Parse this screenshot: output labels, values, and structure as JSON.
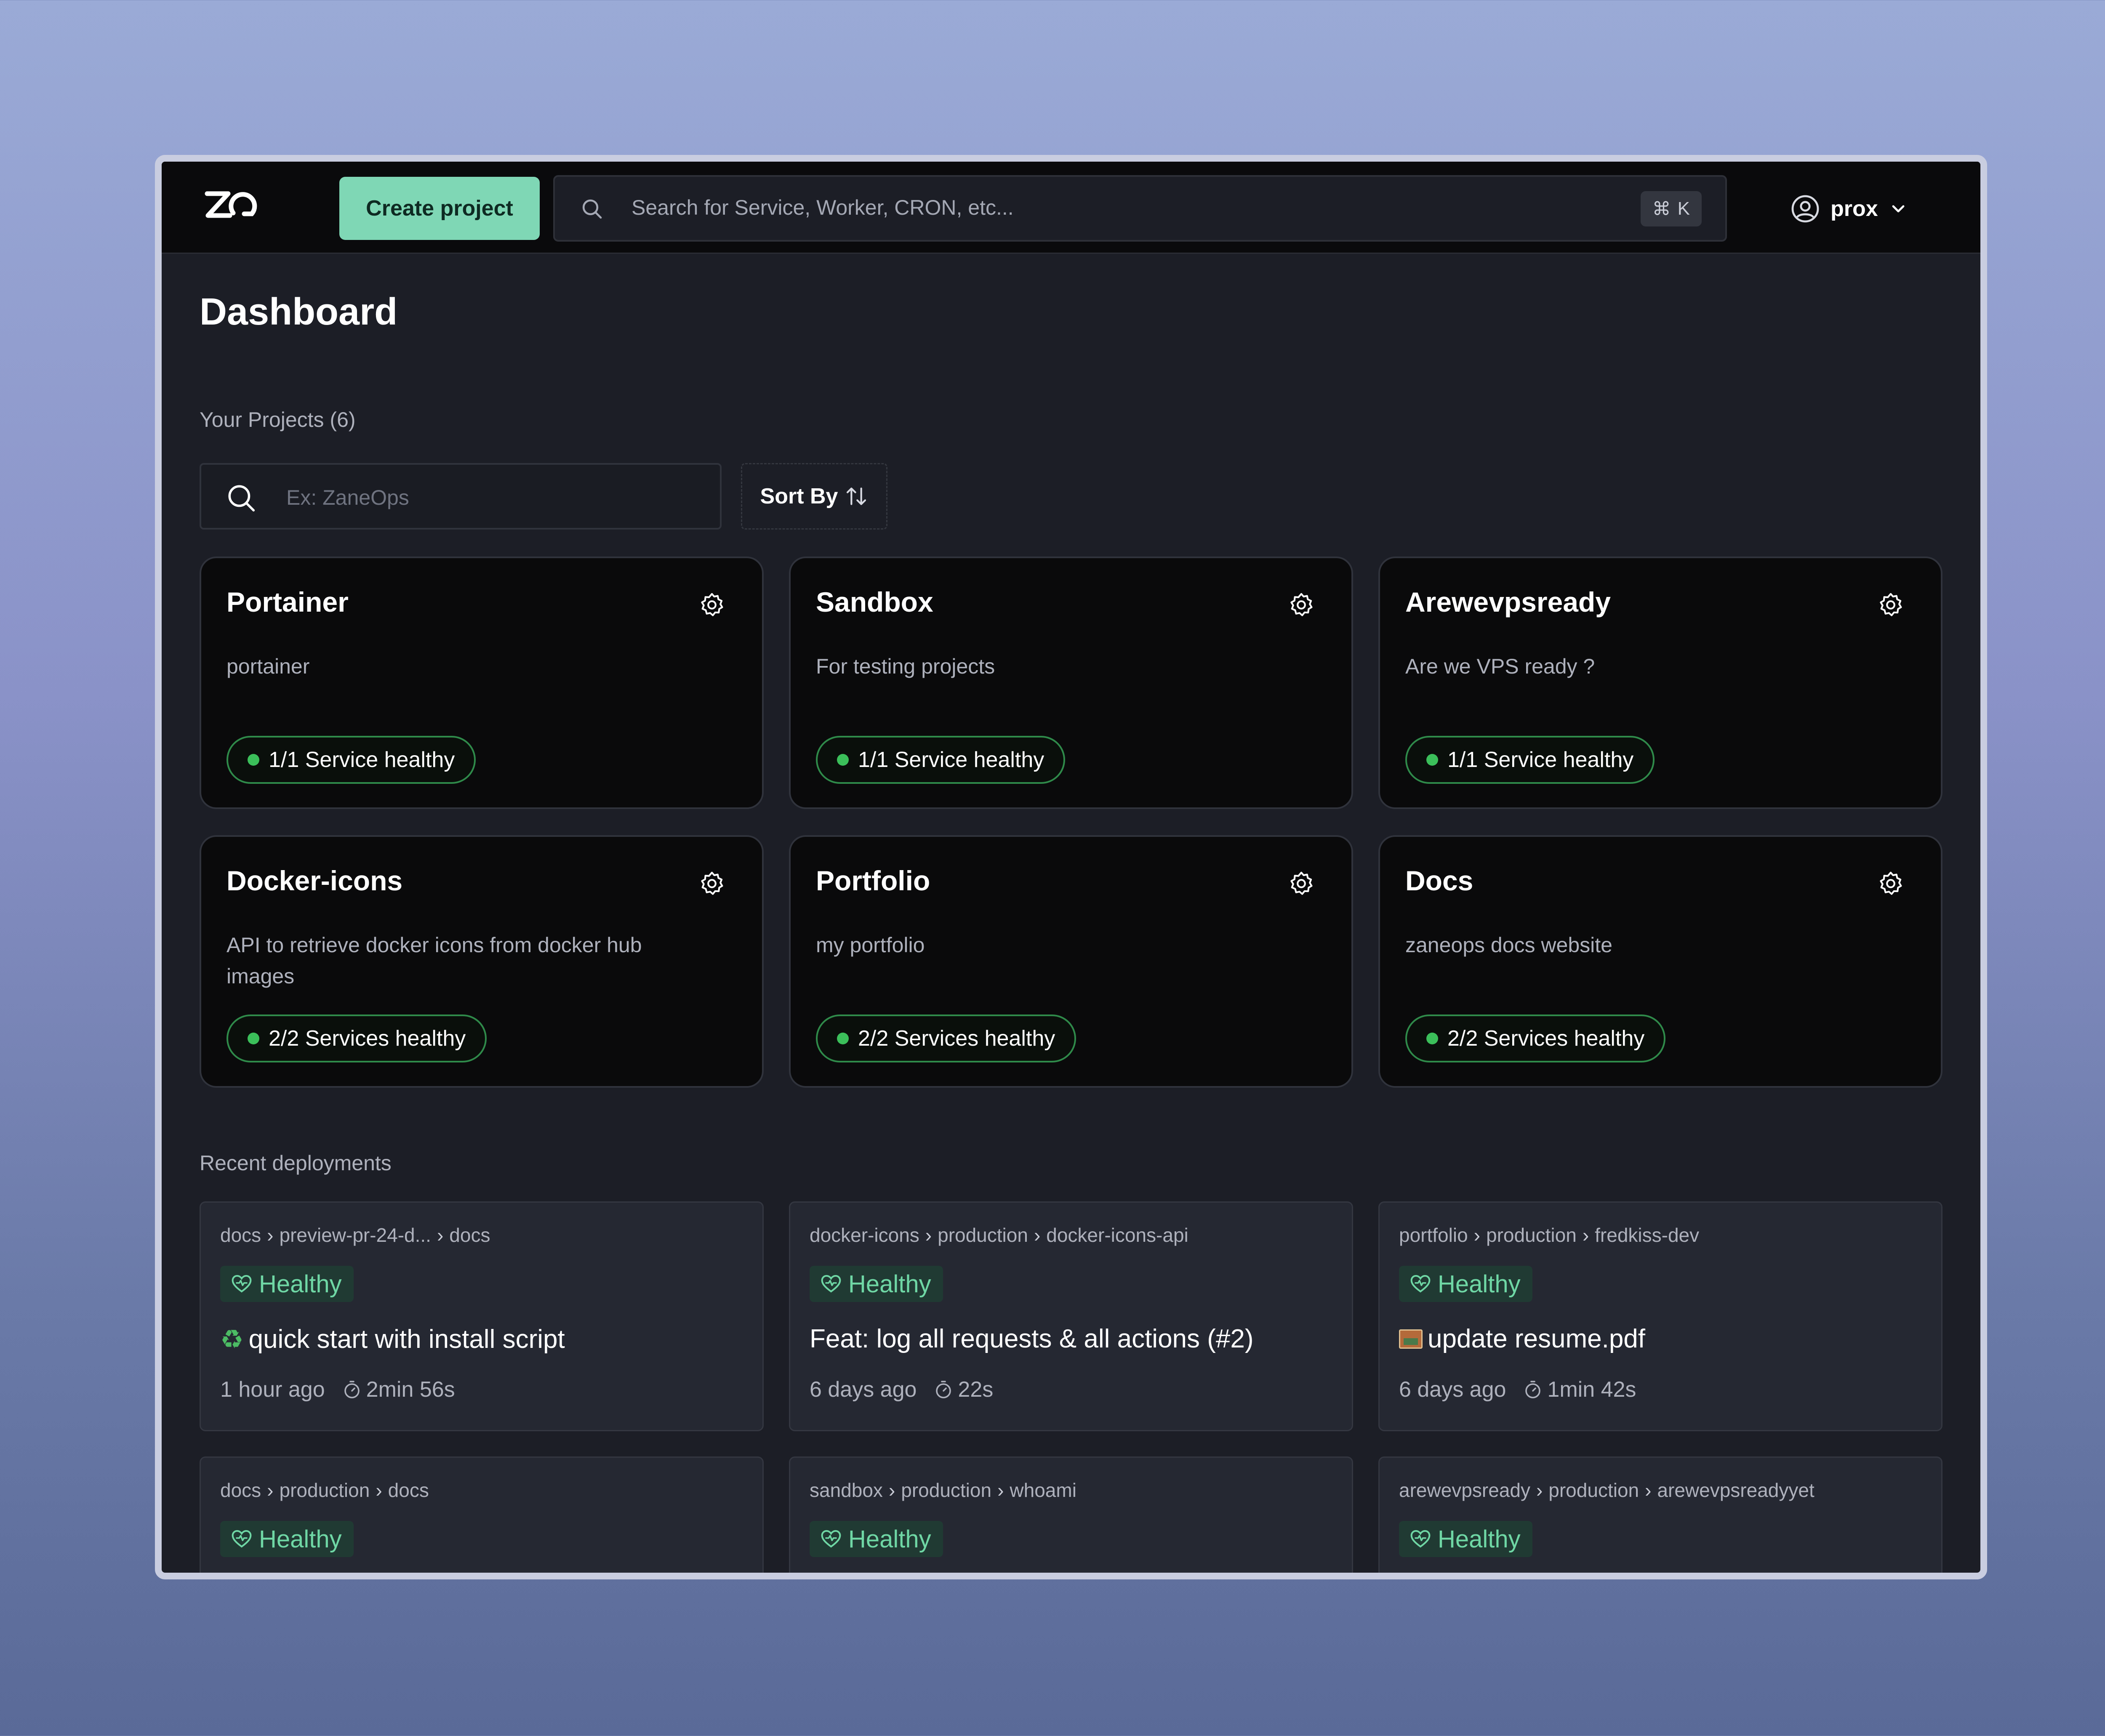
{
  "topbar": {
    "create_label": "Create project",
    "search_placeholder": "Search for Service, Worker, CRON, etc...",
    "shortcut_symbol": "⌘",
    "shortcut_key": "K",
    "username": "prox"
  },
  "dashboard": {
    "title": "Dashboard",
    "projects_heading": "Your Projects (6)",
    "project_search_placeholder": "Ex: ZaneOps",
    "sort_label": "Sort By",
    "recent_heading": "Recent deployments"
  },
  "projects": [
    {
      "name": "Portainer",
      "description": "portainer",
      "status": "1/1 Service healthy"
    },
    {
      "name": "Sandbox",
      "description": "For testing projects",
      "status": "1/1 Service healthy"
    },
    {
      "name": "Arewevpsready",
      "description": "Are we VPS ready ?",
      "status": "1/1 Service healthy"
    },
    {
      "name": "Docker-icons",
      "description": "API to retrieve docker icons from docker hub images",
      "status": "2/2 Services healthy"
    },
    {
      "name": "Portfolio",
      "description": "my portfolio",
      "status": "2/2 Services healthy"
    },
    {
      "name": "Docs",
      "description": "zaneops docs website",
      "status": "2/2 Services healthy"
    }
  ],
  "deployments": [
    {
      "project": "docs",
      "environment": "preview-pr-24-d...",
      "service": "docs",
      "status": "Healthy",
      "message": "quick start with install script",
      "time_ago": "1 hour ago",
      "duration": "2min 56s"
    },
    {
      "project": "docker-icons",
      "environment": "production",
      "service": "docker-icons-api",
      "status": "Healthy",
      "message": "Feat: log all requests & all actions (#2)",
      "time_ago": "6 days ago",
      "duration": "22s"
    },
    {
      "project": "portfolio",
      "environment": "production",
      "service": "fredkiss-dev",
      "status": "Healthy",
      "message": "update resume.pdf",
      "time_ago": "6 days ago",
      "duration": "1min 42s"
    },
    {
      "project": "docs",
      "environment": "production",
      "service": "docs",
      "status": "Healthy"
    },
    {
      "project": "sandbox",
      "environment": "production",
      "service": "whoami",
      "status": "Healthy"
    },
    {
      "project": "arewevpsready",
      "environment": "production",
      "service": "arewevpsreadyyet",
      "status": "Healthy"
    }
  ],
  "colors": {
    "accent": "#7fd7b5",
    "healthy_dot": "#3bbf5a",
    "healthy_text": "#6fd7a5"
  }
}
